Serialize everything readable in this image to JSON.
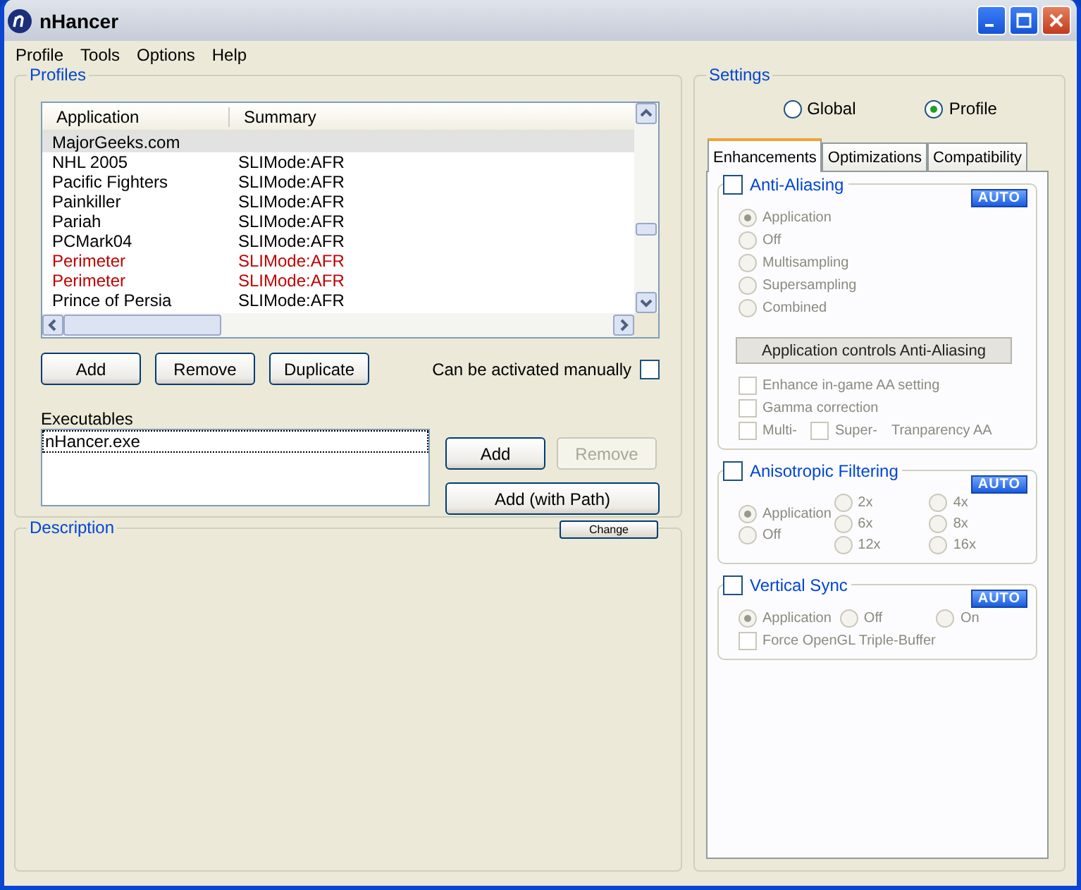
{
  "window": {
    "title": "nHancer"
  },
  "menu": [
    "Profile",
    "Tools",
    "Options",
    "Help"
  ],
  "profiles": {
    "title": "Profiles",
    "columns": [
      "Application",
      "Summary"
    ],
    "rows": [
      {
        "application": "MajorGeeks.com",
        "summary": "",
        "selected": true,
        "flagged": false
      },
      {
        "application": "NHL 2005",
        "summary": "SLIMode:AFR",
        "selected": false,
        "flagged": false
      },
      {
        "application": "Pacific Fighters",
        "summary": "SLIMode:AFR",
        "selected": false,
        "flagged": false
      },
      {
        "application": "Painkiller",
        "summary": "SLIMode:AFR",
        "selected": false,
        "flagged": false
      },
      {
        "application": "Pariah",
        "summary": "SLIMode:AFR",
        "selected": false,
        "flagged": false
      },
      {
        "application": "PCMark04",
        "summary": "SLIMode:AFR",
        "selected": false,
        "flagged": false
      },
      {
        "application": "Perimeter",
        "summary": "SLIMode:AFR",
        "selected": false,
        "flagged": true
      },
      {
        "application": "Perimeter",
        "summary": "SLIMode:AFR",
        "selected": false,
        "flagged": true
      },
      {
        "application": "Prince of Persia",
        "summary": "SLIMode:AFR",
        "selected": false,
        "flagged": false
      }
    ],
    "buttons": [
      "Add",
      "Remove",
      "Duplicate"
    ],
    "manual": {
      "label": "Can be activated manually",
      "checked": false
    },
    "executables": {
      "label": "Executables",
      "items": [
        {
          "text": "nHancer.exe",
          "selected": true
        }
      ],
      "buttons": [
        {
          "label": "Add",
          "disabled": false
        },
        {
          "label": "Remove",
          "disabled": true
        },
        {
          "label": "Add (with Path)",
          "disabled": false
        }
      ]
    }
  },
  "description": {
    "title": "Description",
    "button": "Change"
  },
  "settings": {
    "title": "Settings",
    "scope": [
      {
        "label": "Global",
        "selected": false
      },
      {
        "label": "Profile",
        "selected": true
      }
    ],
    "tabs": [
      {
        "label": "Enhancements",
        "selected": true
      },
      {
        "label": "Optimizations",
        "selected": false
      },
      {
        "label": "Compatibility",
        "selected": false
      }
    ],
    "sections": [
      {
        "title": "Anti-Aliasing",
        "checked": false,
        "badge": "AUTO",
        "kind": "rows",
        "groups": [
          [
            {
              "kind": "radio",
              "label": "Application",
              "selected": true,
              "disabled": true
            }
          ],
          [
            {
              "kind": "radio",
              "label": "Off",
              "selected": false,
              "disabled": true
            }
          ],
          [
            {
              "kind": "radio",
              "label": "Multisampling",
              "selected": false,
              "disabled": true
            }
          ],
          [
            {
              "kind": "radio",
              "label": "Supersampling",
              "selected": false,
              "disabled": true
            }
          ],
          [
            {
              "kind": "radio",
              "label": "Combined",
              "selected": false,
              "disabled": true
            }
          ],
          [
            {
              "kind": "button",
              "label": "Application controls Anti-Aliasing",
              "disabled": true
            }
          ],
          [
            {
              "kind": "checkbox",
              "label": "Enhance in-game AA setting",
              "checked": false,
              "disabled": true
            }
          ],
          [
            {
              "kind": "checkbox",
              "label": "Gamma correction",
              "checked": false,
              "disabled": true
            }
          ],
          [
            {
              "kind": "checkbox",
              "label": "Multi-",
              "checked": false,
              "disabled": true
            },
            {
              "kind": "checkbox",
              "label": "Super-",
              "checked": false,
              "disabled": true
            },
            {
              "kind": "label",
              "label": "Tranparency AA",
              "disabled": true
            }
          ]
        ]
      },
      {
        "title": "Anisotropic Filtering",
        "checked": false,
        "badge": "AUTO",
        "kind": "columns",
        "groups": [
          [
            {
              "kind": "radio",
              "label": "Application",
              "selected": true,
              "disabled": true
            },
            {
              "kind": "radio",
              "label": "Off",
              "selected": false,
              "disabled": true
            }
          ],
          [
            {
              "kind": "radio",
              "label": "2x",
              "selected": false,
              "disabled": true
            },
            {
              "kind": "radio",
              "label": "6x",
              "selected": false,
              "disabled": true
            },
            {
              "kind": "radio",
              "label": "12x",
              "selected": false,
              "disabled": true
            }
          ],
          [
            {
              "kind": "radio",
              "label": "4x",
              "selected": false,
              "disabled": true
            },
            {
              "kind": "radio",
              "label": "8x",
              "selected": false,
              "disabled": true
            },
            {
              "kind": "radio",
              "label": "16x",
              "selected": false,
              "disabled": true
            }
          ]
        ]
      },
      {
        "title": "Vertical Sync",
        "checked": false,
        "badge": "AUTO",
        "kind": "rows",
        "groups": [
          [
            {
              "kind": "radio",
              "label": "Application",
              "selected": true,
              "disabled": true
            },
            {
              "kind": "radio",
              "label": "Off",
              "selected": false,
              "disabled": true
            },
            {
              "kind": "radio",
              "label": "On",
              "selected": false,
              "disabled": true
            }
          ],
          [
            {
              "kind": "checkbox",
              "label": "Force OpenGL Triple-Buffer",
              "checked": false,
              "disabled": true
            }
          ]
        ]
      }
    ]
  }
}
